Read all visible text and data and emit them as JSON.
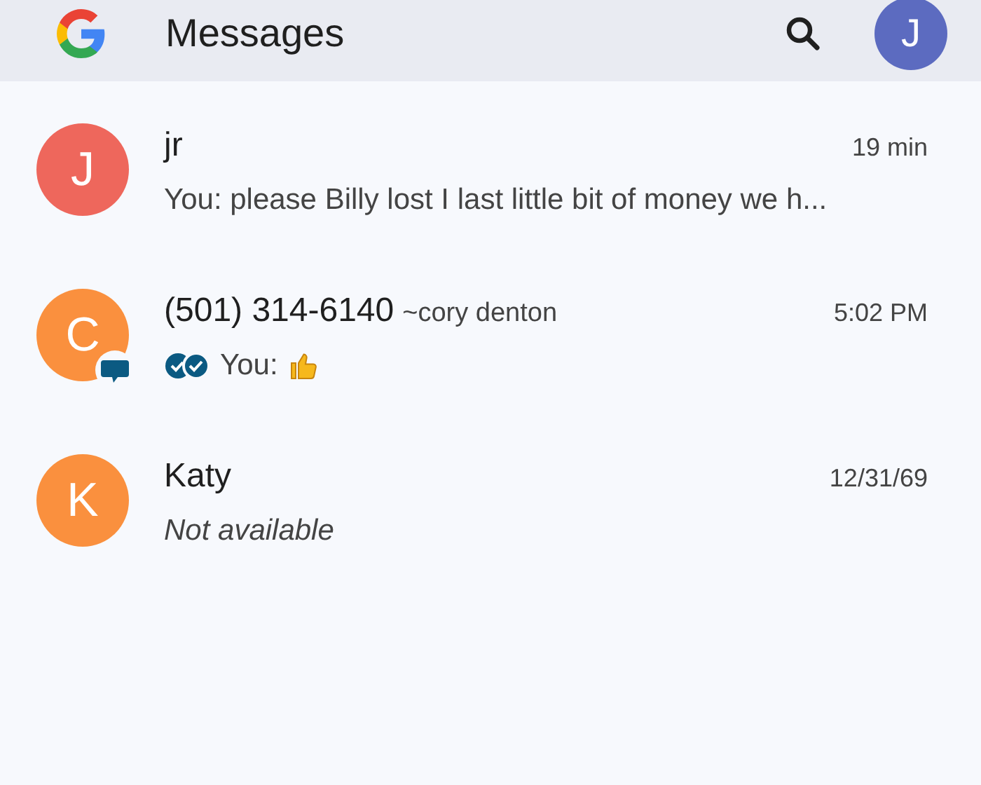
{
  "app_bar": {
    "title": "Messages",
    "account_initial": "J"
  },
  "conversations": [
    {
      "initial": "J",
      "color": "#ee675c",
      "name": "jr",
      "time": "19 min",
      "preview": "You: please Billy lost I last little bit of money we h...",
      "available": true,
      "read_receipt": false,
      "chat_badge": false,
      "thumbs_up": false
    },
    {
      "initial": "C",
      "color": "#fa903e",
      "name": "(501) 314-6140",
      "alias": "~cory denton",
      "time": "5:02 PM",
      "preview": "You:",
      "available": true,
      "read_receipt": true,
      "chat_badge": true,
      "thumbs_up": true
    },
    {
      "initial": "K",
      "color": "#fa903e",
      "name": "Katy",
      "time": "12/31/69",
      "preview": "Not available",
      "available": false,
      "read_receipt": false,
      "chat_badge": false,
      "thumbs_up": false
    }
  ]
}
